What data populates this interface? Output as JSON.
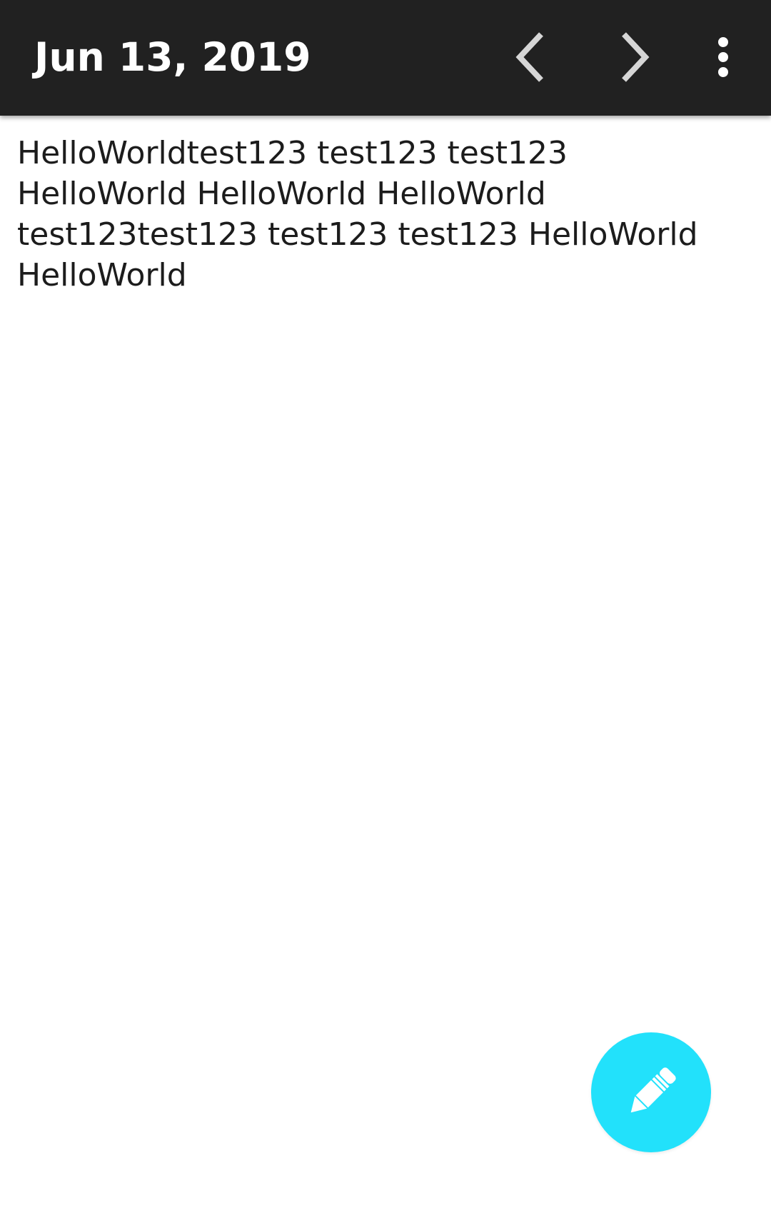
{
  "app_bar": {
    "title": "Jun 13, 2019",
    "background": "#212121",
    "prev_icon": "chevron-left-icon",
    "next_icon": "chevron-right-icon",
    "more_icon": "more-vertical-icon"
  },
  "entry": {
    "text": "HelloWorldtest123 test123 test123 HelloWorld HelloWorld HelloWorld test123test123 test123 test123 HelloWorld HelloWorld"
  },
  "fab": {
    "icon": "pencil-icon",
    "color": "#22e1fb"
  }
}
